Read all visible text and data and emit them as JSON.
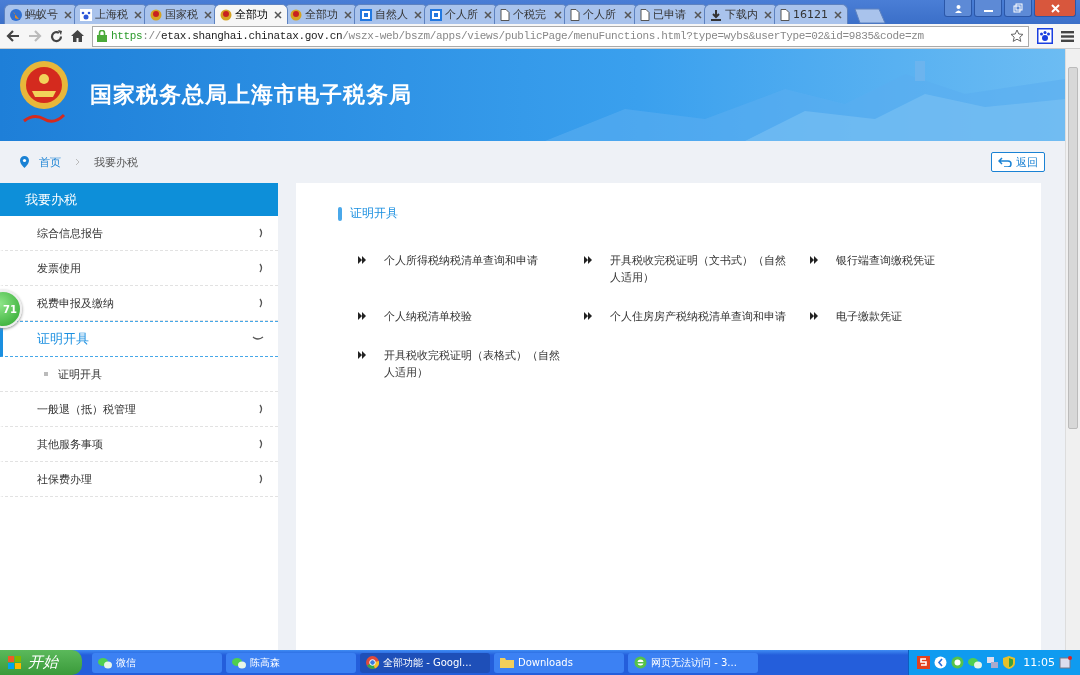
{
  "browser": {
    "tabs": [
      {
        "title": "蚂蚁号",
        "kind": "globe",
        "selected": false
      },
      {
        "title": "上海税",
        "kind": "paw",
        "selected": false
      },
      {
        "title": "国家税",
        "kind": "emblem",
        "selected": false
      },
      {
        "title": "全部功",
        "kind": "emblem",
        "selected": true
      },
      {
        "title": "全部功",
        "kind": "emblem",
        "selected": false
      },
      {
        "title": "自然人",
        "kind": "tax",
        "selected": false
      },
      {
        "title": "个人所",
        "kind": "tax",
        "selected": false
      },
      {
        "title": "个税完",
        "kind": "page",
        "selected": false
      },
      {
        "title": "个人所",
        "kind": "page",
        "selected": false
      },
      {
        "title": "已申请",
        "kind": "page",
        "selected": false
      },
      {
        "title": "下载内",
        "kind": "download",
        "selected": false
      },
      {
        "title": "16121",
        "kind": "page",
        "selected": false
      }
    ],
    "url": {
      "scheme": "https",
      "sep": "://",
      "host": "etax.shanghai.chinatax.gov.cn",
      "path": "/wszx-web/bszm/apps/views/publicPage/menuFunctions.html?type=wybs&userType=02&id=9835&code=zm"
    }
  },
  "header": {
    "title": "国家税务总局上海市电子税务局"
  },
  "breadcrumb": {
    "items": [
      "首页",
      "我要办税"
    ],
    "back_button": "返回"
  },
  "sidebar": {
    "title": "我要办税",
    "badge": "71",
    "items": [
      {
        "label": "综合信息报告",
        "expanded": false
      },
      {
        "label": "发票使用",
        "expanded": false
      },
      {
        "label": "税费申报及缴纳",
        "expanded": false
      },
      {
        "label": "证明开具",
        "expanded": true,
        "children": [
          {
            "label": "证明开具"
          }
        ]
      },
      {
        "label": "一般退（抵）税管理",
        "expanded": false
      },
      {
        "label": "其他服务事项",
        "expanded": false
      },
      {
        "label": "社保费办理",
        "expanded": false
      }
    ]
  },
  "content": {
    "title": "证明开具",
    "links": [
      "个人所得税纳税清单查询和申请",
      "开具税收完税证明（文书式）（自然人适用）",
      "银行端查询缴税凭证",
      "个人纳税清单校验",
      "个人住房房产税纳税清单查询和申请",
      "电子缴款凭证",
      "开具税收完税证明（表格式）（自然人适用）"
    ]
  },
  "taskbar": {
    "start": "开始",
    "items": [
      {
        "label": "微信",
        "kind": "wechat",
        "selected": false
      },
      {
        "label": "陈高森",
        "kind": "wechat",
        "selected": false
      },
      {
        "label": "全部功能 - Googl...",
        "kind": "chrome",
        "selected": true
      },
      {
        "label": "Downloads",
        "kind": "folder",
        "selected": false
      },
      {
        "label": "网页无法访问 - 3...",
        "kind": "ie",
        "selected": false
      }
    ],
    "clock": "11:05"
  }
}
